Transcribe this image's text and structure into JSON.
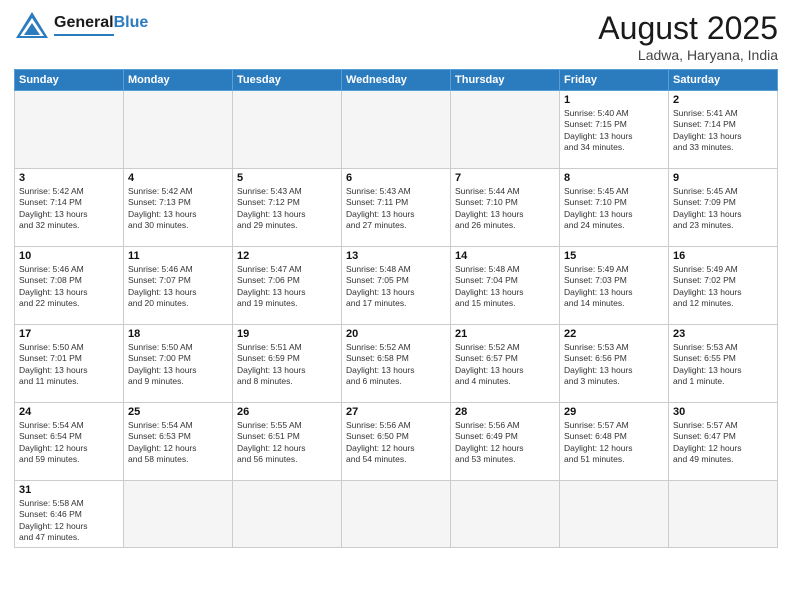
{
  "header": {
    "logo_general": "General",
    "logo_blue": "Blue",
    "month_title": "August 2025",
    "location": "Ladwa, Haryana, India"
  },
  "weekdays": [
    "Sunday",
    "Monday",
    "Tuesday",
    "Wednesday",
    "Thursday",
    "Friday",
    "Saturday"
  ],
  "days": {
    "1": {
      "sunrise": "5:40 AM",
      "sunset": "7:15 PM",
      "daylight": "13 hours and 34 minutes."
    },
    "2": {
      "sunrise": "5:41 AM",
      "sunset": "7:14 PM",
      "daylight": "13 hours and 33 minutes."
    },
    "3": {
      "sunrise": "5:42 AM",
      "sunset": "7:14 PM",
      "daylight": "13 hours and 32 minutes."
    },
    "4": {
      "sunrise": "5:42 AM",
      "sunset": "7:13 PM",
      "daylight": "13 hours and 30 minutes."
    },
    "5": {
      "sunrise": "5:43 AM",
      "sunset": "7:12 PM",
      "daylight": "13 hours and 29 minutes."
    },
    "6": {
      "sunrise": "5:43 AM",
      "sunset": "7:11 PM",
      "daylight": "13 hours and 27 minutes."
    },
    "7": {
      "sunrise": "5:44 AM",
      "sunset": "7:10 PM",
      "daylight": "13 hours and 26 minutes."
    },
    "8": {
      "sunrise": "5:45 AM",
      "sunset": "7:10 PM",
      "daylight": "13 hours and 24 minutes."
    },
    "9": {
      "sunrise": "5:45 AM",
      "sunset": "7:09 PM",
      "daylight": "13 hours and 23 minutes."
    },
    "10": {
      "sunrise": "5:46 AM",
      "sunset": "7:08 PM",
      "daylight": "13 hours and 22 minutes."
    },
    "11": {
      "sunrise": "5:46 AM",
      "sunset": "7:07 PM",
      "daylight": "13 hours and 20 minutes."
    },
    "12": {
      "sunrise": "5:47 AM",
      "sunset": "7:06 PM",
      "daylight": "13 hours and 19 minutes."
    },
    "13": {
      "sunrise": "5:48 AM",
      "sunset": "7:05 PM",
      "daylight": "13 hours and 17 minutes."
    },
    "14": {
      "sunrise": "5:48 AM",
      "sunset": "7:04 PM",
      "daylight": "13 hours and 15 minutes."
    },
    "15": {
      "sunrise": "5:49 AM",
      "sunset": "7:03 PM",
      "daylight": "13 hours and 14 minutes."
    },
    "16": {
      "sunrise": "5:49 AM",
      "sunset": "7:02 PM",
      "daylight": "13 hours and 12 minutes."
    },
    "17": {
      "sunrise": "5:50 AM",
      "sunset": "7:01 PM",
      "daylight": "13 hours and 11 minutes."
    },
    "18": {
      "sunrise": "5:50 AM",
      "sunset": "7:00 PM",
      "daylight": "13 hours and 9 minutes."
    },
    "19": {
      "sunrise": "5:51 AM",
      "sunset": "6:59 PM",
      "daylight": "13 hours and 8 minutes."
    },
    "20": {
      "sunrise": "5:52 AM",
      "sunset": "6:58 PM",
      "daylight": "13 hours and 6 minutes."
    },
    "21": {
      "sunrise": "5:52 AM",
      "sunset": "6:57 PM",
      "daylight": "13 hours and 4 minutes."
    },
    "22": {
      "sunrise": "5:53 AM",
      "sunset": "6:56 PM",
      "daylight": "13 hours and 3 minutes."
    },
    "23": {
      "sunrise": "5:53 AM",
      "sunset": "6:55 PM",
      "daylight": "13 hours and 1 minute."
    },
    "24": {
      "sunrise": "5:54 AM",
      "sunset": "6:54 PM",
      "daylight": "12 hours and 59 minutes."
    },
    "25": {
      "sunrise": "5:54 AM",
      "sunset": "6:53 PM",
      "daylight": "12 hours and 58 minutes."
    },
    "26": {
      "sunrise": "5:55 AM",
      "sunset": "6:51 PM",
      "daylight": "12 hours and 56 minutes."
    },
    "27": {
      "sunrise": "5:56 AM",
      "sunset": "6:50 PM",
      "daylight": "12 hours and 54 minutes."
    },
    "28": {
      "sunrise": "5:56 AM",
      "sunset": "6:49 PM",
      "daylight": "12 hours and 53 minutes."
    },
    "29": {
      "sunrise": "5:57 AM",
      "sunset": "6:48 PM",
      "daylight": "12 hours and 51 minutes."
    },
    "30": {
      "sunrise": "5:57 AM",
      "sunset": "6:47 PM",
      "daylight": "12 hours and 49 minutes."
    },
    "31": {
      "sunrise": "5:58 AM",
      "sunset": "6:46 PM",
      "daylight": "12 hours and 47 minutes."
    }
  }
}
